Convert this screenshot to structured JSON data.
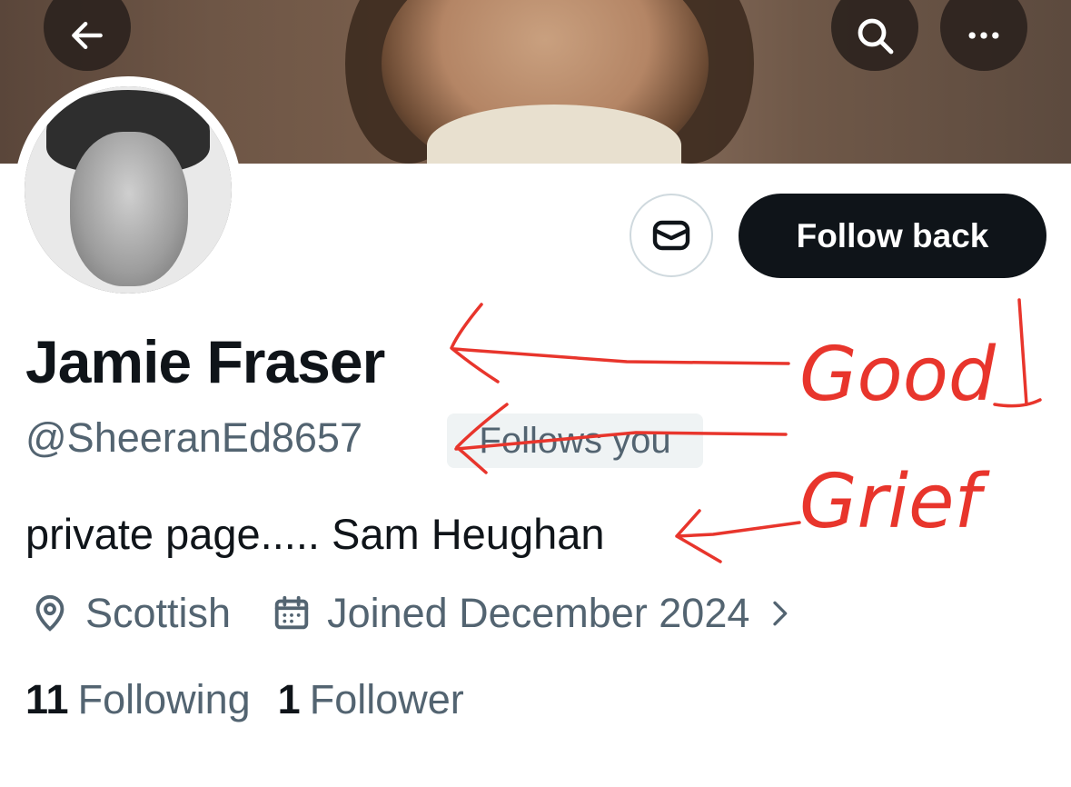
{
  "header": {
    "back_icon": "arrow-left-icon",
    "search_icon": "search-icon",
    "more_icon": "more-horizontal-icon"
  },
  "profile": {
    "name": "Jamie Fraser",
    "handle": "@SheeranEd8657",
    "follows_you": "Follows you",
    "bio": "private page..... Sam Heughan",
    "location": "Scottish",
    "joined": "Joined December 2024",
    "following_count": "11",
    "following_label": "Following",
    "followers_count": "1",
    "followers_label": "Follower"
  },
  "actions": {
    "message_icon": "envelope-icon",
    "follow_back_label": "Follow back"
  },
  "annotation": {
    "word1": "Good",
    "word2": "Grief",
    "color": "#e8352c"
  },
  "colors": {
    "primary_text": "#0f1419",
    "secondary_text": "#536471",
    "button_dark": "#0f1419",
    "badge_bg": "#eff3f4"
  }
}
